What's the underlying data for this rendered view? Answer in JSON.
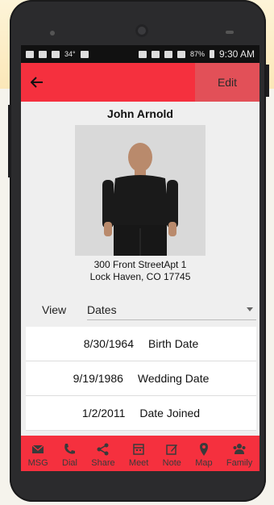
{
  "status": {
    "temperature": "34°",
    "battery": "87%",
    "time": "9:30 AM"
  },
  "appbar": {
    "edit_label": "Edit"
  },
  "contact": {
    "name": "John Arnold",
    "address_line1": "300 Front StreetApt 1",
    "address_line2": "Lock Haven, CO 17745"
  },
  "view": {
    "label": "View",
    "selected": "Dates"
  },
  "dates": [
    {
      "date": "8/30/1964",
      "label": "Birth Date"
    },
    {
      "date": "9/19/1986",
      "label": "Wedding Date"
    },
    {
      "date": "1/2/2011",
      "label": "Date Joined"
    }
  ],
  "tabs": [
    {
      "label": "MSG",
      "icon": "mail-icon"
    },
    {
      "label": "Dial",
      "icon": "phone-icon"
    },
    {
      "label": "Share",
      "icon": "share-icon"
    },
    {
      "label": "Meet",
      "icon": "calendar-icon"
    },
    {
      "label": "Note",
      "icon": "note-icon"
    },
    {
      "label": "Map",
      "icon": "map-pin-icon"
    },
    {
      "label": "Family",
      "icon": "family-icon"
    }
  ],
  "colors": {
    "accent": "#f5303e",
    "edit_highlight": "#e25058"
  }
}
